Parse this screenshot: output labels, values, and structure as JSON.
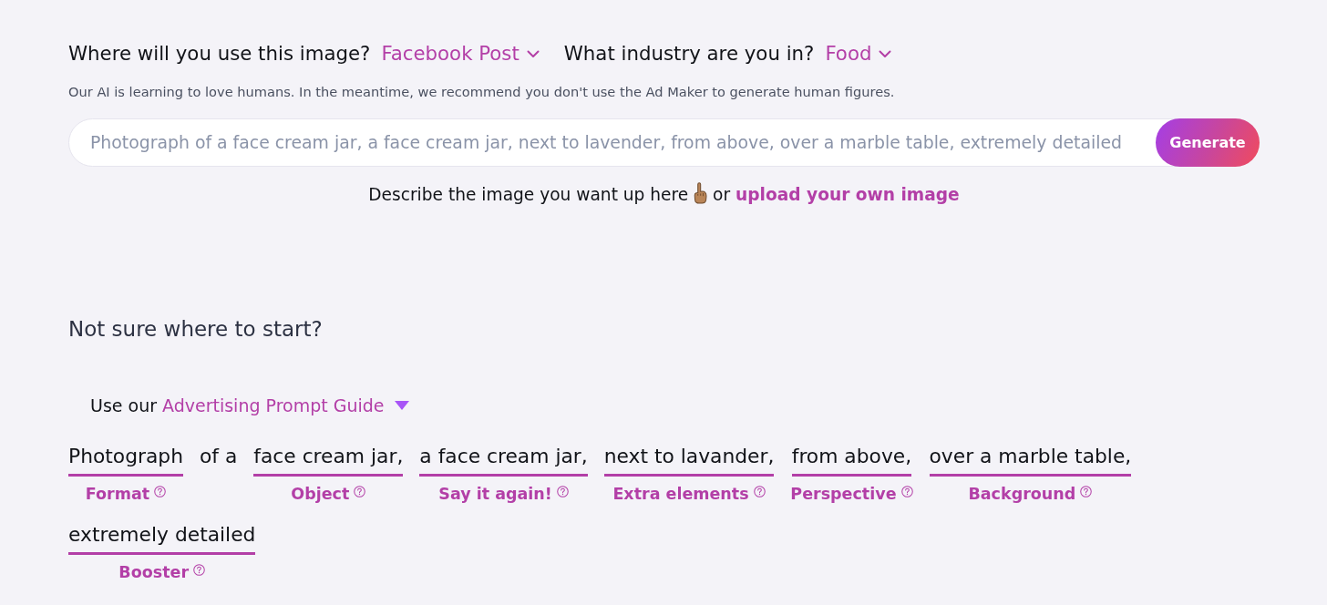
{
  "questions": [
    {
      "label": "Where will you use this image?",
      "value": "Facebook Post"
    },
    {
      "label": "What industry are you in?",
      "value": "Food"
    }
  ],
  "notice": "Our AI is learning to love humans. In the meantime, we recommend you don't use the Ad Maker to generate human figures.",
  "prompt_input": {
    "placeholder": "Photograph of a face cream jar, a face cream jar, next to lavender, from above, over a marble table, extremely detailed"
  },
  "generate_button": "Generate",
  "hint": {
    "text": "Describe the image you want up here",
    "joiner": "or",
    "link": "upload your own image"
  },
  "section_title": "Not sure where to start?",
  "guide": {
    "prefix": "Use our",
    "link": "Advertising Prompt Guide"
  },
  "prompt_parts": [
    {
      "kind": "segment",
      "text": "Photograph",
      "label": "Format"
    },
    {
      "kind": "plain",
      "text": "of a"
    },
    {
      "kind": "segment",
      "text": "face cream jar,",
      "label": "Object"
    },
    {
      "kind": "segment",
      "text": "a face cream jar,",
      "label": "Say it again!"
    },
    {
      "kind": "segment",
      "text": "next to lavander,",
      "label": "Extra elements"
    },
    {
      "kind": "segment",
      "text": "from above,",
      "label": "Perspective"
    },
    {
      "kind": "segment",
      "text": "over a marble table,",
      "label": "Background"
    },
    {
      "kind": "segment",
      "text": "extremely detailed",
      "label": "Booster"
    }
  ]
}
